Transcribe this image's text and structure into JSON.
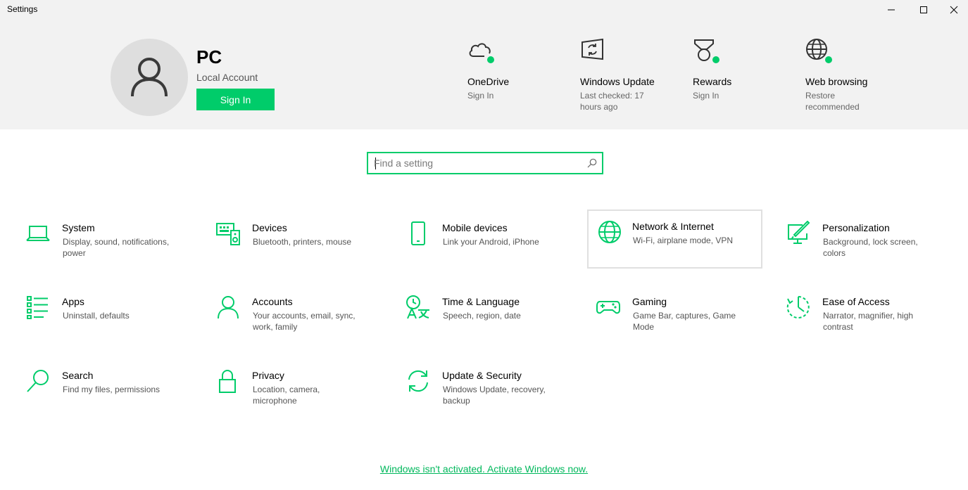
{
  "window": {
    "title": "Settings"
  },
  "account": {
    "name": "PC",
    "type": "Local Account",
    "sign_in_label": "Sign In"
  },
  "quick": [
    {
      "title": "OneDrive",
      "subtitle": "Sign In",
      "icon": "cloud-icon"
    },
    {
      "title": "Windows Update",
      "subtitle": "Last checked: 17 hours ago",
      "icon": "windows-update-icon"
    },
    {
      "title": "Rewards",
      "subtitle": "Sign In",
      "icon": "rewards-icon"
    },
    {
      "title": "Web browsing",
      "subtitle": "Restore recommended",
      "icon": "globe-icon"
    }
  ],
  "search": {
    "placeholder": "Find a setting"
  },
  "categories": [
    {
      "title": "System",
      "desc": "Display, sound, notifications, power",
      "icon": "laptop-icon"
    },
    {
      "title": "Devices",
      "desc": "Bluetooth, printers, mouse",
      "icon": "keyboard-speaker-icon"
    },
    {
      "title": "Mobile devices",
      "desc": "Link your Android, iPhone",
      "icon": "phone-icon"
    },
    {
      "title": "Network & Internet",
      "desc": "Wi-Fi, airplane mode, VPN",
      "icon": "globe-icon"
    },
    {
      "title": "Personalization",
      "desc": "Background, lock screen, colors",
      "icon": "paint-monitor-icon"
    },
    {
      "title": "Apps",
      "desc": "Uninstall, defaults",
      "icon": "apps-list-icon"
    },
    {
      "title": "Accounts",
      "desc": "Your accounts, email, sync, work, family",
      "icon": "person-icon"
    },
    {
      "title": "Time & Language",
      "desc": "Speech, region, date",
      "icon": "time-language-icon"
    },
    {
      "title": "Gaming",
      "desc": "Game Bar, captures, Game Mode",
      "icon": "gamepad-icon"
    },
    {
      "title": "Ease of Access",
      "desc": "Narrator, magnifier, high contrast",
      "icon": "ease-of-access-icon"
    },
    {
      "title": "Search",
      "desc": "Find my files, permissions",
      "icon": "search-icon"
    },
    {
      "title": "Privacy",
      "desc": "Location, camera, microphone",
      "icon": "lock-icon"
    },
    {
      "title": "Update & Security",
      "desc": "Windows Update, recovery, backup",
      "icon": "sync-arrows-icon"
    }
  ],
  "activation_link": "Windows isn't activated. Activate Windows now.",
  "colors": {
    "accent": "#00cc6a",
    "header_bg": "#f2f2f2",
    "hover_border": "#e0e0e0"
  }
}
